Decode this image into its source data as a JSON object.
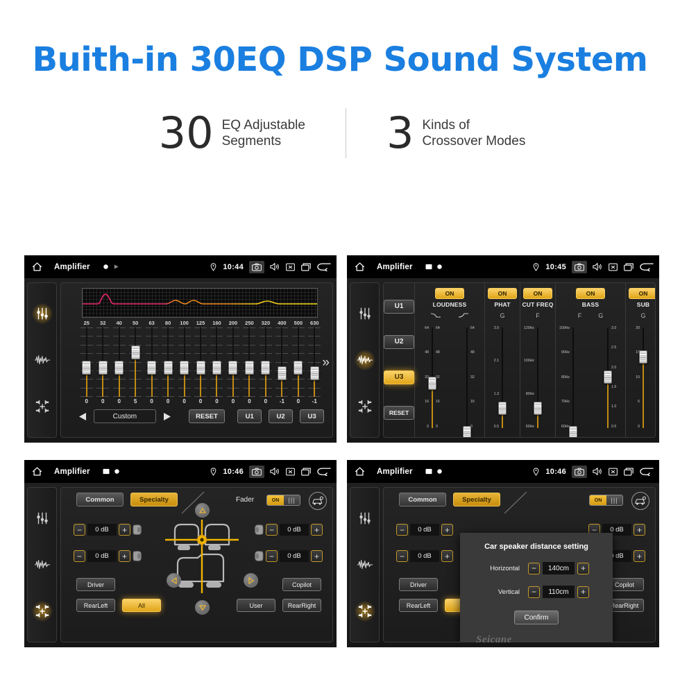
{
  "header": {
    "title": "Buith-in 30EQ DSP Sound System",
    "stats": [
      {
        "number": "30",
        "line1": "EQ Adjustable",
        "line2": "Segments"
      },
      {
        "number": "3",
        "line1": "Kinds of",
        "line2": "Crossover Modes"
      }
    ]
  },
  "colors": {
    "title_blue": "#1a7fe0",
    "accent_amber": "#e0a518",
    "panel_dark": "#1c1c1c",
    "curve_pink": "#e8246c",
    "curve_orange": "#f08a1a",
    "curve_yellow": "#f2e016"
  },
  "panel_eq": {
    "statusbar": {
      "home_icon": "home-icon",
      "title": "Amplifier",
      "mini_icons": [
        "dot-icon",
        "play-icon"
      ],
      "location_icon": "location-pin-icon",
      "time": "10:44",
      "right_icons": [
        "camera-icon",
        "volume-icon",
        "mute-box-icon",
        "recents-icon",
        "back-icon"
      ]
    },
    "sidebar": [
      {
        "name": "equalizer-icon",
        "active": true
      },
      {
        "name": "waveform-icon",
        "active": false
      },
      {
        "name": "balance-icon",
        "active": false
      }
    ],
    "graph": {
      "label": "eq-response-curve"
    },
    "frequencies": [
      "25",
      "32",
      "40",
      "50",
      "63",
      "80",
      "100",
      "125",
      "160",
      "200",
      "250",
      "320",
      "400",
      "500",
      "630"
    ],
    "values": [
      "0",
      "0",
      "0",
      "5",
      "0",
      "0",
      "0",
      "0",
      "0",
      "0",
      "0",
      "0",
      "-1",
      "0",
      "-1"
    ],
    "slider_positions": [
      52,
      52,
      52,
      30,
      52,
      52,
      52,
      52,
      52,
      52,
      52,
      52,
      60,
      52,
      60
    ],
    "preset": "Custom",
    "prev_icon": "triangle-left-icon",
    "next_icon": "triangle-right-icon",
    "reset_label": "RESET",
    "user_presets": [
      "U1",
      "U2",
      "U3"
    ],
    "more_icon": "chevron-double-right-icon"
  },
  "panel_crossover": {
    "statusbar": {
      "title": "Amplifier",
      "mini_icons": [
        "image-icon",
        "dot-icon"
      ],
      "time": "10:45",
      "right_icons": [
        "camera-icon",
        "volume-icon",
        "mute-box-icon",
        "recents-icon",
        "back-icon"
      ]
    },
    "sidebar": [
      {
        "name": "equalizer-icon",
        "active": false
      },
      {
        "name": "waveform-icon",
        "active": true
      },
      {
        "name": "balance-icon",
        "active": false
      }
    ],
    "units": [
      {
        "label": "U1",
        "selected": false
      },
      {
        "label": "U2",
        "selected": false
      },
      {
        "label": "U3",
        "selected": true
      },
      {
        "label": "RESET",
        "selected": false
      }
    ],
    "sections": [
      {
        "on_label": "ON",
        "name": "LOUDNESS",
        "sliders": [
          {
            "sub": "curve-down-icon",
            "scale_left": [
              "64",
              "48",
              "32",
              "16",
              "0"
            ],
            "scale_right": [
              "64",
              "48",
              "32",
              "16",
              "0"
            ],
            "knob_pct": 48
          },
          {
            "sub": "curve-up-icon",
            "scale_left": [],
            "scale_right": [
              "64",
              "48",
              "32",
              "16",
              "0"
            ],
            "knob_pct": 92
          }
        ]
      },
      {
        "on_label": "ON",
        "name": "PHAT",
        "sliders": [
          {
            "sub": "G",
            "scale_left": [
              "3.0",
              "2.1",
              "1.3",
              "0.5"
            ],
            "scale_right": [],
            "knob_pct": 70
          }
        ]
      },
      {
        "on_label": "ON",
        "name": "CUT FREQ",
        "sliders": [
          {
            "sub": "F",
            "scale_left": [
              "120Hz",
              "100Hz",
              "80Hz",
              "60Hz"
            ],
            "scale_right": [],
            "knob_pct": 70
          }
        ]
      },
      {
        "on_label": "ON",
        "name": "BASS",
        "sliders": [
          {
            "sub": "F",
            "scale_left": [
              "100Hz",
              "90Hz",
              "80Hz",
              "70Hz",
              "60Hz"
            ],
            "scale_right": [],
            "knob_pct": 92
          },
          {
            "sub": "G",
            "scale_left": [],
            "scale_right": [
              "3.0",
              "2.5",
              "2.0",
              "1.5",
              "1.0",
              "0.5"
            ],
            "knob_pct": 42
          }
        ]
      },
      {
        "on_label": "ON",
        "name": "SUB",
        "sliders": [
          {
            "sub": "G",
            "scale_left": [
              "20",
              "15",
              "10",
              "5",
              "0"
            ],
            "scale_right": [],
            "knob_pct": 24
          }
        ]
      }
    ]
  },
  "panel_fader": {
    "statusbar": {
      "title": "Amplifier",
      "mini_icons": [
        "image-icon",
        "dot-icon"
      ],
      "time": "10:46",
      "right_icons": [
        "camera-icon",
        "volume-icon",
        "mute-box-icon",
        "recents-icon",
        "back-icon"
      ]
    },
    "sidebar": [
      {
        "name": "equalizer-icon",
        "active": false
      },
      {
        "name": "waveform-icon",
        "active": false
      },
      {
        "name": "balance-icon",
        "active": true
      }
    ],
    "tabs": [
      {
        "label": "Common",
        "selected": false
      },
      {
        "label": "Specialty",
        "selected": true
      }
    ],
    "fader": {
      "label": "Fader",
      "toggle_state": "ON",
      "grip_icon": "grip-handle-icon"
    },
    "car_settings_icon": "car-speaker-icon",
    "speakers": [
      {
        "position": "front-left",
        "value": "0 dB",
        "minus": "−",
        "plus": "+"
      },
      {
        "position": "rear-left",
        "value": "0 dB",
        "minus": "−",
        "plus": "+"
      },
      {
        "position": "front-right",
        "value": "0 dB",
        "minus": "−",
        "plus": "+"
      },
      {
        "position": "rear-right",
        "value": "0 dB",
        "minus": "−",
        "plus": "+"
      }
    ],
    "nav_icons": [
      "triangle-up-icon",
      "triangle-left-icon",
      "triangle-right-icon",
      "triangle-down-icon"
    ],
    "seat_diagram_icon": "car-seats-crosshair-icon",
    "position_buttons": [
      {
        "label": "Driver",
        "selected": false
      },
      {
        "label": "Copilot",
        "selected": false
      },
      {
        "label": "RearLeft",
        "selected": false
      },
      {
        "label": "All",
        "selected": true
      },
      {
        "label": "User",
        "selected": false
      },
      {
        "label": "RearRight",
        "selected": false
      }
    ]
  },
  "panel_dialog": {
    "statusbar": {
      "title": "Amplifier",
      "time": "10:46"
    },
    "dialog": {
      "title": "Car speaker distance setting",
      "rows": [
        {
          "label": "Horizontal",
          "value": "140cm",
          "minus": "−",
          "plus": "+"
        },
        {
          "label": "Vertical",
          "value": "110cm",
          "minus": "−",
          "plus": "+"
        }
      ],
      "confirm_label": "Confirm"
    },
    "watermark": "Seicane"
  }
}
